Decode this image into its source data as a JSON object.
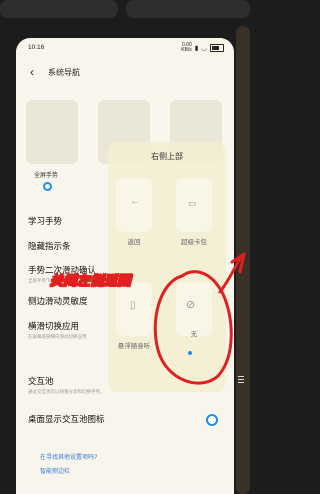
{
  "status_bar": {
    "time": "10:16",
    "net_top": "0.00",
    "net_bottom": "KB/s"
  },
  "header": {
    "title": "系统导航"
  },
  "modes": [
    {
      "label": "全屏手势",
      "selected": true
    }
  ],
  "rows": [
    {
      "title": "学习手势",
      "subtitle": ""
    },
    {
      "title": "隐藏指示条",
      "subtitle": ""
    },
    {
      "title": "手势二次滑动确认",
      "subtitle": "全屏手势下, 从屏幕两侧..."
    },
    {
      "title": "侧边滑动灵敏度",
      "subtitle": ""
    },
    {
      "title": "横滑切换应用",
      "subtitle": "在屏幕底部横向滑动切换应用"
    },
    {
      "title": "交互池",
      "subtitle": "通过交互池可以快速分享和切换手势。"
    },
    {
      "title": "桌面显示交互池图标",
      "subtitle": ""
    }
  ],
  "links": {
    "question": "在寻找其他设置项吗?",
    "edge": "智能侧边栏"
  },
  "popup": {
    "title": "右侧上部",
    "options": [
      {
        "label": "返回"
      },
      {
        "label": "超级卡包"
      },
      {
        "label": "悬浮随身听"
      },
      {
        "label": "无",
        "selected": true
      }
    ]
  },
  "annotation": {
    "text": "关闭左侧返回",
    "color": "#e02020"
  },
  "colors": {
    "accent": "#1e8ff0",
    "background": "#f7f5ec"
  }
}
